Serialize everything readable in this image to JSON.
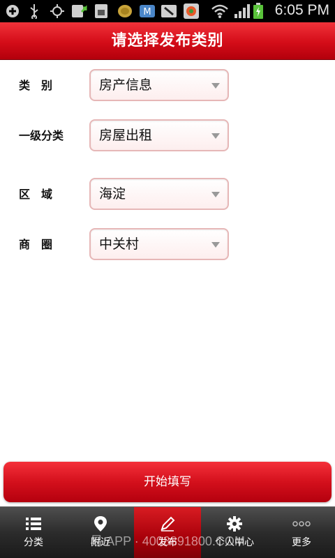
{
  "status_bar": {
    "time": "6:05 PM",
    "icons": [
      "add-icon",
      "usb-icon",
      "gps-icon",
      "download-icon",
      "sim-icon",
      "coin-icon",
      "mail-icon",
      "phone-icon",
      "app-icon",
      "wifi-icon",
      "signal-icon",
      "battery-icon"
    ]
  },
  "header": {
    "title": "请选择发布类别"
  },
  "form": {
    "rows": [
      {
        "label": "类　别",
        "value": "房产信息"
      },
      {
        "label": "一级分类",
        "value": "房屋出租"
      },
      {
        "label": "区　域",
        "value": "海淀"
      },
      {
        "label": "商　圈",
        "value": "中关村"
      }
    ]
  },
  "start_button": {
    "label": "开始填写"
  },
  "nav": {
    "items": [
      {
        "label": "分类",
        "icon": "list-icon"
      },
      {
        "label": "附近",
        "icon": "location-pin-icon"
      },
      {
        "label": "发布",
        "icon": "pencil-icon",
        "active": true
      },
      {
        "label": "个人中心",
        "icon": "gear-icon"
      },
      {
        "label": "更多",
        "icon": "more-dots-icon"
      }
    ]
  },
  "watermark": "易 APP · 4008891800.COM"
}
